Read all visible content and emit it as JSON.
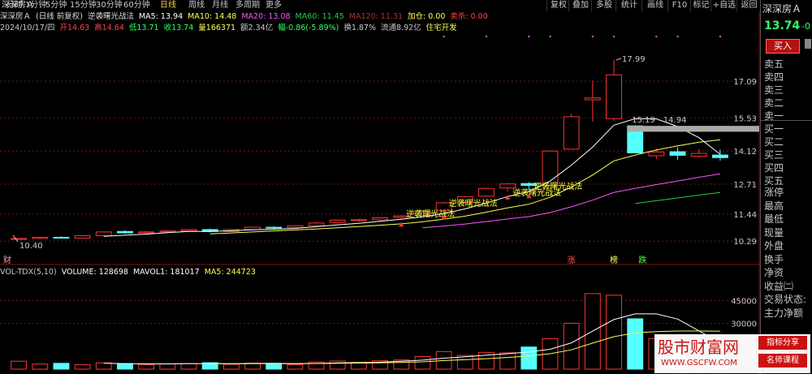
{
  "colors": {
    "up": "#ff3333",
    "down": "#54ffff",
    "ma5": "#ffffff",
    "ma10": "#ffff55",
    "ma20": "#ff55ff",
    "ma60": "#22cc44",
    "ma120": "#aa3333",
    "grid": "#7a1414",
    "text": "#c8c8c8",
    "accent": "#ffd24d",
    "signal": "#ffff33"
  },
  "menu": {
    "stock_name": "深深房Ａ",
    "timeframes": [
      "分时",
      "1分钟",
      "5分钟",
      "15分钟",
      "30分钟",
      "60分钟",
      "日线",
      "周线",
      "月线",
      "多周期",
      "更多"
    ],
    "active_timeframe": "日线",
    "tools": [
      "复权",
      "叠加",
      "多股",
      "统计",
      "画线",
      "F10",
      "标记",
      "+自选",
      "返回"
    ]
  },
  "info": {
    "name": "深深房Ａ",
    "mode": "(日线 前复权)",
    "indicator": "逆袭曙光战法",
    "ma5": "MA5: 13.94",
    "ma10": "MA10: 14.48",
    "ma20": "MA20: 13.08",
    "ma60": "MA60: 11.45",
    "ma120": "MA120: 11.31",
    "jiahe": "加仓: 0.00",
    "jianmian": "卖杀: 0.00"
  },
  "quote": {
    "date": "2024/10/17/四",
    "open": "开14.63",
    "high": "高14.64",
    "low": "低13.71",
    "close": "收13.74",
    "vol": "量166371",
    "amount": "额2.34亿",
    "change": "幅-0.86(-5.89%)",
    "turnover": "换1.87%",
    "float": "流通8.92亿",
    "sector": "住宅开发"
  },
  "volume_header": {
    "name": "VOL-TDX(5,10)",
    "volume": "VOLUME: 128698",
    "mavol1": "MAVOL1: 181017",
    "ma5": "MA5: 244723"
  },
  "chart_data": {
    "type": "candlestick",
    "price_axis_ticks": [
      "17.09",
      "15.53",
      "14.12",
      "12.71",
      "11.44",
      "10.29"
    ],
    "volume_axis_ticks": [
      "45000",
      "30000"
    ],
    "annotations": [
      "17.99",
      "15.19 - 14.94",
      "10.40"
    ],
    "signal_label": "逆袭曙光战法",
    "markers": [
      "财",
      "涨",
      "榜",
      "跌"
    ],
    "candles": [
      {
        "o": 10.38,
        "h": 10.42,
        "l": 10.34,
        "c": 10.4,
        "v": 5200
      },
      {
        "o": 10.4,
        "h": 10.48,
        "l": 10.36,
        "c": 10.45,
        "v": 3300
      },
      {
        "o": 10.45,
        "h": 10.5,
        "l": 10.4,
        "c": 10.42,
        "v": 3800
      },
      {
        "o": 10.42,
        "h": 10.55,
        "l": 10.41,
        "c": 10.52,
        "v": 2900
      },
      {
        "o": 10.52,
        "h": 10.7,
        "l": 10.5,
        "c": 10.68,
        "v": 4100
      },
      {
        "o": 10.7,
        "h": 10.76,
        "l": 10.6,
        "c": 10.64,
        "v": 3600
      },
      {
        "o": 10.64,
        "h": 10.72,
        "l": 10.6,
        "c": 10.68,
        "v": 3000
      },
      {
        "o": 10.68,
        "h": 10.75,
        "l": 10.62,
        "c": 10.72,
        "v": 3500
      },
      {
        "o": 10.72,
        "h": 10.8,
        "l": 10.68,
        "c": 10.78,
        "v": 3700
      },
      {
        "o": 10.78,
        "h": 10.82,
        "l": 10.66,
        "c": 10.7,
        "v": 4200
      },
      {
        "o": 10.7,
        "h": 10.8,
        "l": 10.68,
        "c": 10.78,
        "v": 3200
      },
      {
        "o": 10.78,
        "h": 10.9,
        "l": 10.76,
        "c": 10.88,
        "v": 3900
      },
      {
        "o": 10.88,
        "h": 10.92,
        "l": 10.8,
        "c": 10.85,
        "v": 3800
      },
      {
        "o": 10.86,
        "h": 10.96,
        "l": 10.84,
        "c": 10.94,
        "v": 3000
      },
      {
        "o": 10.94,
        "h": 11.1,
        "l": 10.92,
        "c": 11.06,
        "v": 4600
      },
      {
        "o": 11.08,
        "h": 11.2,
        "l": 11.04,
        "c": 11.18,
        "v": 5300
      },
      {
        "o": 11.18,
        "h": 11.24,
        "l": 11.1,
        "c": 11.2,
        "v": 4500
      },
      {
        "o": 11.2,
        "h": 11.3,
        "l": 11.15,
        "c": 11.28,
        "v": 5500
      },
      {
        "o": 11.3,
        "h": 11.4,
        "l": 11.25,
        "c": 11.36,
        "v": 6000
      },
      {
        "o": 11.38,
        "h": 11.58,
        "l": 11.36,
        "c": 11.56,
        "v": 8300
      },
      {
        "o": 11.6,
        "h": 11.96,
        "l": 11.56,
        "c": 11.92,
        "v": 11500
      },
      {
        "o": 11.95,
        "h": 12.2,
        "l": 11.9,
        "c": 12.18,
        "v": 9000
      },
      {
        "o": 12.2,
        "h": 12.56,
        "l": 12.18,
        "c": 12.53,
        "v": 11000
      },
      {
        "o": 12.55,
        "h": 12.76,
        "l": 12.4,
        "c": 12.72,
        "v": 10700
      },
      {
        "o": 12.74,
        "h": 12.8,
        "l": 12.46,
        "c": 12.66,
        "v": 14500
      },
      {
        "o": 12.66,
        "h": 14.12,
        "l": 12.66,
        "c": 14.12,
        "v": 20000
      },
      {
        "o": 14.2,
        "h": 15.71,
        "l": 14.2,
        "c": 15.58,
        "v": 30000
      },
      {
        "o": 16.3,
        "h": 17.12,
        "l": 15.38,
        "c": 16.38,
        "v": 49500
      },
      {
        "o": 15.5,
        "h": 17.99,
        "l": 15.4,
        "c": 17.36,
        "v": 48500
      },
      {
        "o": 15.19,
        "h": 15.19,
        "l": 14.04,
        "c": 14.04,
        "v": 33000
      },
      {
        "o": 13.92,
        "h": 14.2,
        "l": 13.78,
        "c": 14.08,
        "v": 20000
      },
      {
        "o": 14.09,
        "h": 14.28,
        "l": 13.75,
        "c": 13.94,
        "v": 13000
      },
      {
        "o": 13.9,
        "h": 14.2,
        "l": 13.85,
        "c": 14.02,
        "v": 11000
      },
      {
        "o": 13.95,
        "h": 14.18,
        "l": 13.71,
        "c": 13.84,
        "v": 9000
      }
    ]
  },
  "right_panel": {
    "stock_name": "深深房Ａ",
    "last_price": "13.74",
    "change_short": "-0",
    "buy_button": "买入",
    "order_book": [
      "卖五",
      "卖四",
      "卖三",
      "卖二",
      "卖一",
      "买一",
      "买二",
      "买三",
      "买四",
      "买五"
    ],
    "stats": [
      "涨停",
      "最高",
      "最低",
      "现量",
      "外盘",
      "换手",
      "净资",
      "收益㈡",
      "交易状态:",
      "主力净额"
    ]
  },
  "watermark": {
    "brand": "股市财富网",
    "url": "WWW.GSCFW.COM",
    "tag1": "指标分享",
    "tag2": "名师课程"
  }
}
